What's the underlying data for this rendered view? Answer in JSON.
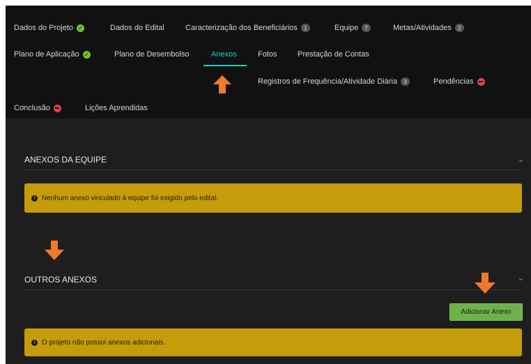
{
  "tabs": {
    "row1": [
      {
        "label": "Dados do Projeto",
        "badge": "ok"
      },
      {
        "label": "Dados do Edital"
      },
      {
        "label": "Caracterização dos Beneficiários",
        "badge": "1"
      },
      {
        "label": "Equipe",
        "badge": "7"
      },
      {
        "label": "Metas/Atividades",
        "badge": "2"
      }
    ],
    "row2": [
      {
        "label": "Plano de Aplicação",
        "badge": "ok"
      },
      {
        "label": "Plano de Desembolso"
      },
      {
        "label": "Anexos",
        "active": true
      },
      {
        "label": "Fotos"
      },
      {
        "label": "Prestação de Contas"
      }
    ],
    "row3": [
      {
        "label": "Registros de Frequência/Atividade Diária",
        "badge": "3"
      },
      {
        "label": "Pendências",
        "badge": "error"
      }
    ],
    "row4": [
      {
        "label": "Conclusão",
        "badge": "error"
      },
      {
        "label": "Lições Aprendidas"
      }
    ]
  },
  "sections": {
    "team": {
      "title": "ANEXOS DA EQUIPE",
      "alert": "Nenhum anexo vinculado à equipe foi exigido pelo edital."
    },
    "other": {
      "title": "OUTROS ANEXOS",
      "button": "Adicionar Anexo",
      "alert": "O projeto não possui anexos adicionais."
    }
  },
  "colors": {
    "active_tab": "#1fd3c6",
    "success": "#72c02c",
    "danger": "#e0424d",
    "warning": "#c49c0c",
    "button": "#6eb04a",
    "annotation_arrow": "#f07a2c"
  },
  "icons": {
    "ok": "check-circle-icon",
    "error": "minus-circle-icon",
    "chevron": "chevron-down-icon",
    "alert": "exclamation-circle-icon",
    "annotation": "arrow-icon"
  }
}
